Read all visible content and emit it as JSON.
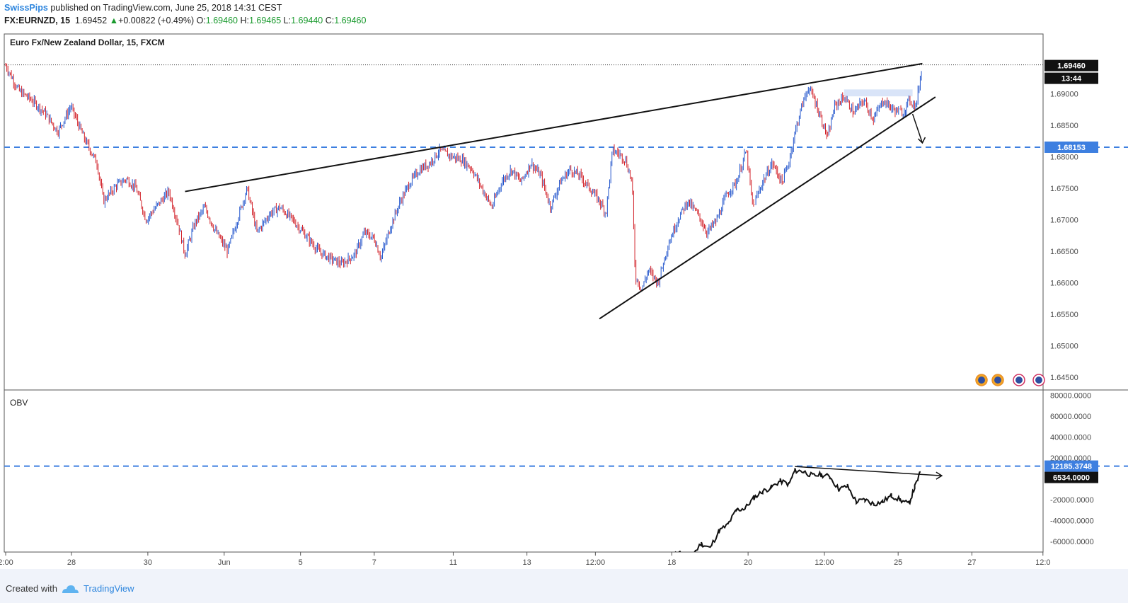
{
  "header": {
    "author": "SwissPips",
    "published": " published on TradingView.com, June 25, 2018 14:31 CEST",
    "symbol": "FX:EURNZD, 15",
    "last": "1.69452",
    "change_arrow": "▲",
    "change": "+0.00822 (+0.49%)",
    "o_label": "O:",
    "o": "1.69460",
    "h_label": "H:",
    "h": "1.69465",
    "l_label": "L:",
    "l": "1.69440",
    "c_label": "C:",
    "c": "1.69460"
  },
  "footer": {
    "created": "Created with",
    "brand": "TradingView"
  },
  "colors": {
    "up": "#2255cc",
    "down": "#d2222a",
    "level": "#3d7fe0",
    "trend": "#111111"
  },
  "chart_data": [
    {
      "type": "candlestick",
      "title": "Euro Fx/New Zealand Dollar, 15, FXCM",
      "ylim": [
        1.643,
        1.6995
      ],
      "yticks": [
        "1.69000",
        "1.68500",
        "1.68000",
        "1.67500",
        "1.67000",
        "1.66500",
        "1.66000",
        "1.65500",
        "1.65000",
        "1.64500"
      ],
      "xticks": [
        "2:00",
        "28",
        "30",
        "Jun",
        "5",
        "7",
        "11",
        "13",
        "12:00",
        "18",
        "20",
        "12:00",
        "25",
        "27",
        "12:0"
      ],
      "price_series": [
        [
          0,
          1.6945
        ],
        [
          4,
          1.6905
        ],
        [
          8,
          1.689
        ],
        [
          12,
          1.687
        ],
        [
          16,
          1.684
        ],
        [
          20,
          1.688
        ],
        [
          24,
          1.683
        ],
        [
          28,
          1.679
        ],
        [
          30,
          1.673
        ],
        [
          34,
          1.6755
        ],
        [
          37,
          1.6765
        ],
        [
          40,
          1.675
        ],
        [
          43,
          1.67
        ],
        [
          46,
          1.672
        ],
        [
          50,
          1.6745
        ],
        [
          53,
          1.669
        ],
        [
          55,
          1.6645
        ],
        [
          58,
          1.6695
        ],
        [
          61,
          1.672
        ],
        [
          64,
          1.6685
        ],
        [
          68,
          1.665
        ],
        [
          71,
          1.67
        ],
        [
          74,
          1.675
        ],
        [
          77,
          1.668
        ],
        [
          81,
          1.671
        ],
        [
          84,
          1.672
        ],
        [
          88,
          1.67
        ],
        [
          92,
          1.6675
        ],
        [
          96,
          1.665
        ],
        [
          99,
          1.664
        ],
        [
          103,
          1.663
        ],
        [
          107,
          1.6645
        ],
        [
          110,
          1.668
        ],
        [
          113,
          1.667
        ],
        [
          115,
          1.664
        ],
        [
          118,
          1.669
        ],
        [
          121,
          1.673
        ],
        [
          124,
          1.676
        ],
        [
          127,
          1.678
        ],
        [
          130,
          1.679
        ],
        [
          133,
          1.681
        ],
        [
          137,
          1.68
        ],
        [
          140,
          1.6795
        ],
        [
          143,
          1.678
        ],
        [
          146,
          1.675
        ],
        [
          149,
          1.672
        ],
        [
          152,
          1.676
        ],
        [
          155,
          1.678
        ],
        [
          158,
          1.676
        ],
        [
          161,
          1.679
        ],
        [
          164,
          1.677
        ],
        [
          167,
          1.672
        ],
        [
          170,
          1.676
        ],
        [
          173,
          1.678
        ],
        [
          176,
          1.677
        ],
        [
          179,
          1.675
        ],
        [
          182,
          1.673
        ],
        [
          184,
          1.671
        ],
        [
          186,
          1.681
        ],
        [
          188,
          1.6805
        ],
        [
          190,
          1.6795
        ],
        [
          192,
          1.676
        ],
        [
          193,
          1.661
        ],
        [
          195,
          1.659
        ],
        [
          197,
          1.662
        ],
        [
          200,
          1.66
        ],
        [
          203,
          1.666
        ],
        [
          206,
          1.67
        ],
        [
          209,
          1.673
        ],
        [
          212,
          1.671
        ],
        [
          215,
          1.668
        ],
        [
          218,
          1.67
        ],
        [
          221,
          1.674
        ],
        [
          224,
          1.676
        ],
        [
          227,
          1.681
        ],
        [
          229,
          1.672
        ],
        [
          232,
          1.676
        ],
        [
          235,
          1.679
        ],
        [
          238,
          1.676
        ],
        [
          240,
          1.679
        ],
        [
          242,
          1.684
        ],
        [
          244,
          1.688
        ],
        [
          246,
          1.691
        ],
        [
          248,
          1.689
        ],
        [
          250,
          1.686
        ],
        [
          252,
          1.683
        ],
        [
          254,
          1.688
        ],
        [
          257,
          1.6895
        ],
        [
          260,
          1.687
        ],
        [
          263,
          1.689
        ],
        [
          266,
          1.686
        ],
        [
          269,
          1.689
        ],
        [
          272,
          1.6875
        ],
        [
          275,
          1.687
        ],
        [
          277,
          1.689
        ],
        [
          279,
          1.688
        ],
        [
          281,
          1.6946
        ]
      ],
      "horizontal_level": 1.68153,
      "last_price_line": 1.6946,
      "price_labels": {
        "last": "1.69460",
        "countdown": "13:44",
        "level": "1.68153"
      },
      "trendlines": [
        {
          "from": [
            55,
            1.6745
          ],
          "to": [
            281,
            1.6948
          ]
        },
        {
          "from": [
            182,
            1.6543
          ],
          "to": [
            285,
            1.6895
          ]
        }
      ]
    },
    {
      "type": "line",
      "title": "OBV",
      "ylim": [
        -70000,
        85000
      ],
      "yticks": [
        "80000.0000",
        "60000.0000",
        "40000.0000",
        "20000.0000",
        "0.0000",
        "-20000.0000",
        "-40000.0000",
        "-60000.0000"
      ],
      "series": [
        {
          "values": [
            [
              225,
              -78000
            ],
            [
              230,
              -70000
            ],
            [
              234,
              -76000
            ],
            [
              238,
              -62000
            ],
            [
              241,
              -66000
            ],
            [
              244,
              -50000
            ],
            [
              247,
              -44000
            ],
            [
              250,
              -30000
            ],
            [
              253,
              -28000
            ],
            [
              256,
              -18000
            ],
            [
              259,
              -12000
            ],
            [
              262,
              -8000
            ],
            [
              265,
              -2000
            ],
            [
              268,
              -5000
            ],
            [
              270,
              8000
            ],
            [
              273,
              7000
            ],
            [
              276,
              3000
            ],
            [
              279,
              4000
            ],
            [
              282,
              2000
            ],
            [
              285,
              -10000
            ],
            [
              288,
              -7000
            ],
            [
              291,
              -22000
            ],
            [
              294,
              -20000
            ],
            [
              297,
              -24000
            ],
            [
              300,
              -22000
            ],
            [
              303,
              -16000
            ],
            [
              306,
              -20000
            ],
            [
              309,
              -24000
            ],
            [
              311,
              -8000
            ],
            [
              313,
              6534
            ]
          ]
        }
      ],
      "horizontal_level": 12185.3748,
      "value_labels": {
        "level": "12185.3748",
        "last": "6534.0000"
      }
    }
  ]
}
